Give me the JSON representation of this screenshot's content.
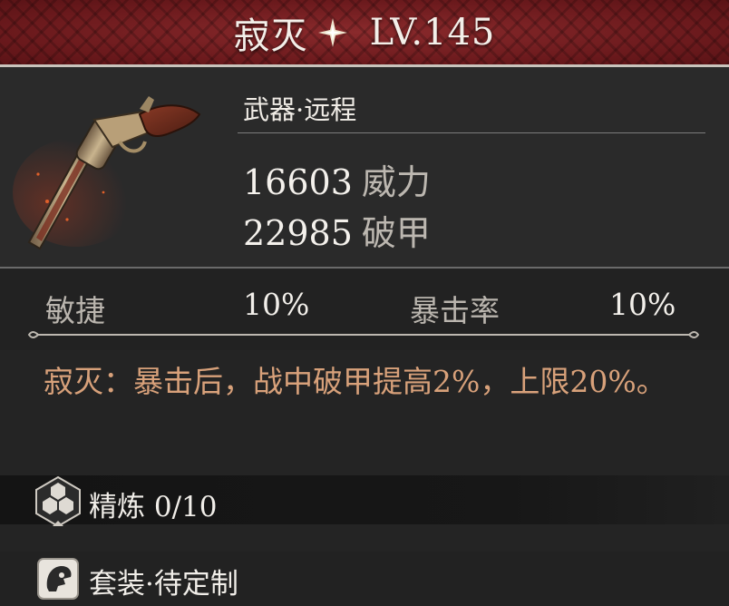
{
  "header": {
    "name": "寂灭",
    "level": "LV.145",
    "icon": "four-point-star-icon"
  },
  "weapon": {
    "category": "武器·远程",
    "stats": [
      {
        "value": "16603",
        "name": "威力"
      },
      {
        "value": "22985",
        "name": "破甲"
      }
    ],
    "image": "revolver-icon"
  },
  "substats": [
    {
      "name": "敏捷",
      "value": "10%"
    },
    {
      "name": "暴击率",
      "value": "10%"
    }
  ],
  "description": "寂灭：暴击后，战中破甲提高2%，上限20%。",
  "refine": {
    "label": "精炼 0/10",
    "icon": "refine-hexagon-icon"
  },
  "set": {
    "label": "套装·待定制",
    "icon": "helmet-icon"
  },
  "colors": {
    "header_red": "#6d1a1e",
    "description": "#d8a17a",
    "background": "#242424"
  }
}
